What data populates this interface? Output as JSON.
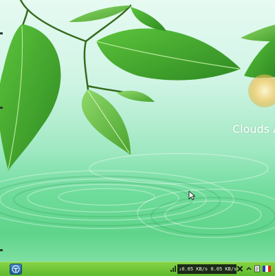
{
  "desktop": {
    "widget_label": "Clouds A"
  },
  "taskbar": {
    "start_icon": "start-menu-icon",
    "network_speed": "↓0.05 KB/s  0.05 KB/s",
    "tray_icons": [
      "network-icon",
      "close-x-icon",
      "chevron-up-icon",
      "document-icon",
      "language-flag-icon"
    ],
    "language_flag_colors": [
      "#1f3fb0",
      "#ffffff",
      "#e2231a"
    ]
  },
  "colors": {
    "taskbar_green": "#6cc535",
    "background_top": "#e6faf2",
    "water_green": "#5fd48a",
    "leaf_green": "#3e9b2d"
  }
}
